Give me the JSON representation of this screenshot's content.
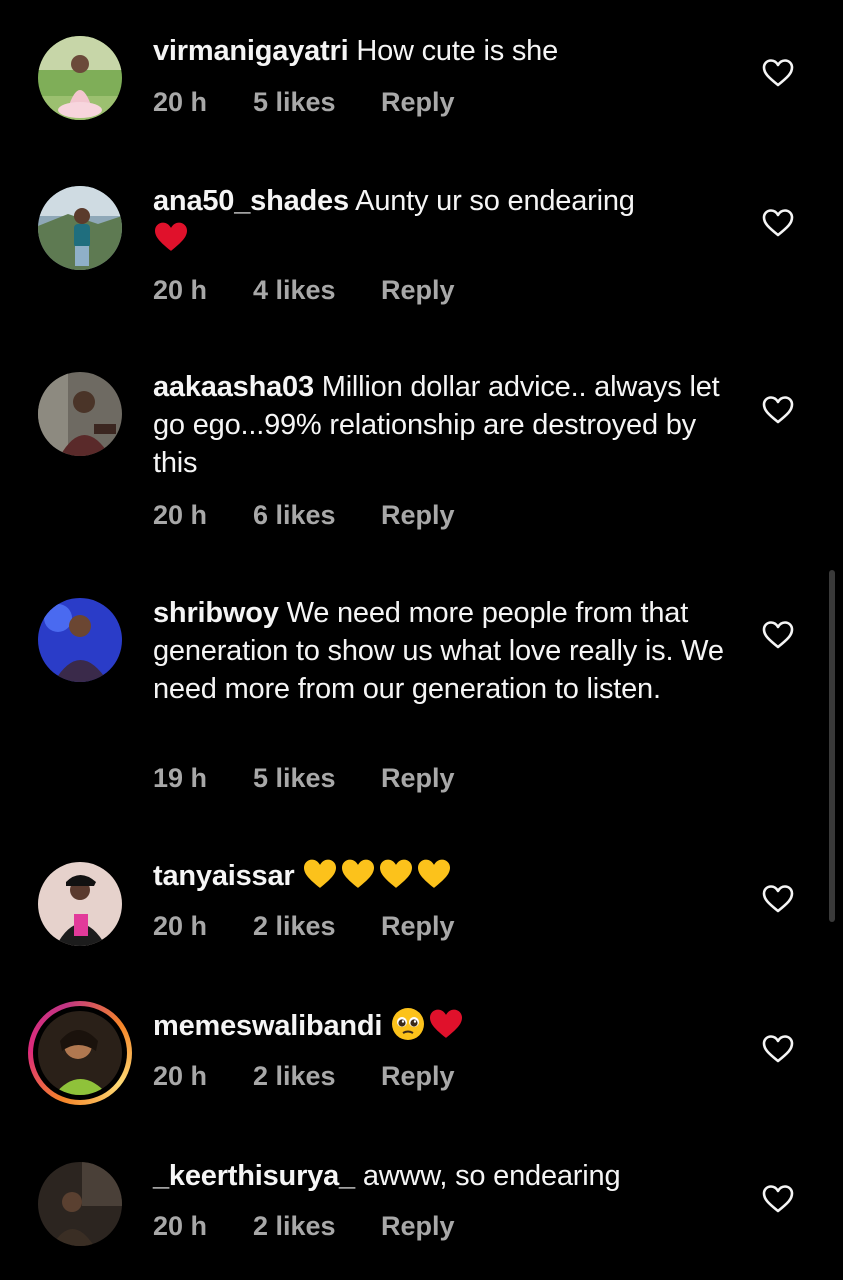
{
  "comments": [
    {
      "username": "virmanigayatri",
      "text": "How cute is she",
      "time": "20 h",
      "likes": "5 likes",
      "reply": "Reply",
      "emojis": []
    },
    {
      "username": "ana50_shades",
      "text": "Aunty ur so endearing",
      "time": "20 h",
      "likes": "4 likes",
      "reply": "Reply",
      "emojis": [
        "red-heart"
      ]
    },
    {
      "username": "aakaasha03",
      "text": "Million dollar advice.. always let go ego...99% relationship are destroyed by this",
      "time": "20 h",
      "likes": "6 likes",
      "reply": "Reply",
      "emojis": []
    },
    {
      "username": "shribwoy",
      "text": "We need more people from that generation to show us what love really is. We need more from our generation to listen.",
      "time": "19 h",
      "likes": "5 likes",
      "reply": "Reply",
      "emojis": []
    },
    {
      "username": "tanyaissar",
      "text": "",
      "time": "20 h",
      "likes": "2 likes",
      "reply": "Reply",
      "emojis": [
        "yellow-heart",
        "yellow-heart",
        "yellow-heart",
        "yellow-heart"
      ]
    },
    {
      "username": "memeswalibandi",
      "text": "",
      "time": "20 h",
      "likes": "2 likes",
      "reply": "Reply",
      "emojis": [
        "pleading-face",
        "red-heart"
      ]
    },
    {
      "username": "_keerthisurya_",
      "text": "awww, so endearing",
      "time": "20 h",
      "likes": "2 likes",
      "reply": "Reply",
      "emojis": []
    }
  ],
  "icons": {
    "like": "heart-outline-icon",
    "red_heart": "red-heart-emoji",
    "yellow_heart": "yellow-heart-emoji",
    "pleading": "pleading-face-emoji"
  },
  "colors": {
    "background": "#000000",
    "text": "#f5f5f5",
    "meta": "#a8a8a8",
    "red_heart": "#e0112b",
    "yellow_heart": "#fcc21b"
  }
}
